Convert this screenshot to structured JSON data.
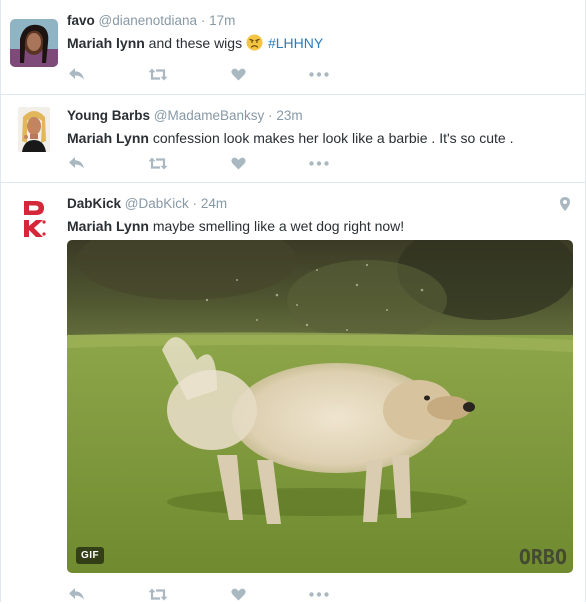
{
  "tweets": [
    {
      "name": "favo",
      "handle": "@dianenotdiana",
      "dot": "·",
      "time": "17m",
      "text_bold": "Mariah lynn",
      "text_rest": " and these wigs ",
      "emoji": "disappointed-face",
      "hashtag": "#LHHNY"
    },
    {
      "name": "Young Barbs",
      "handle": "@MadameBanksy",
      "dot": "·",
      "time": "23m",
      "text_bold": "Mariah Lynn",
      "text_rest": " confession look makes her look like a barbie . It's so cute ."
    },
    {
      "name": "DabKick",
      "handle": "@DabKick",
      "dot": "·",
      "time": "24m",
      "text_bold": "Mariah Lynn",
      "text_rest": " maybe smelling like a wet dog right now!",
      "logo_text": "DK",
      "gif_badge": "GIF",
      "watermark": "ORBO"
    }
  ],
  "icons": [
    "reply-icon",
    "retweet-icon",
    "like-icon",
    "more-icon",
    "location-pin-icon"
  ],
  "colors": {
    "action_gray": "#aab8c2",
    "meta_gray": "#8899a6",
    "hashtag_blue": "#2b7bb9",
    "border": "#e1e8ed",
    "dabkick_red": "#d6263a"
  }
}
